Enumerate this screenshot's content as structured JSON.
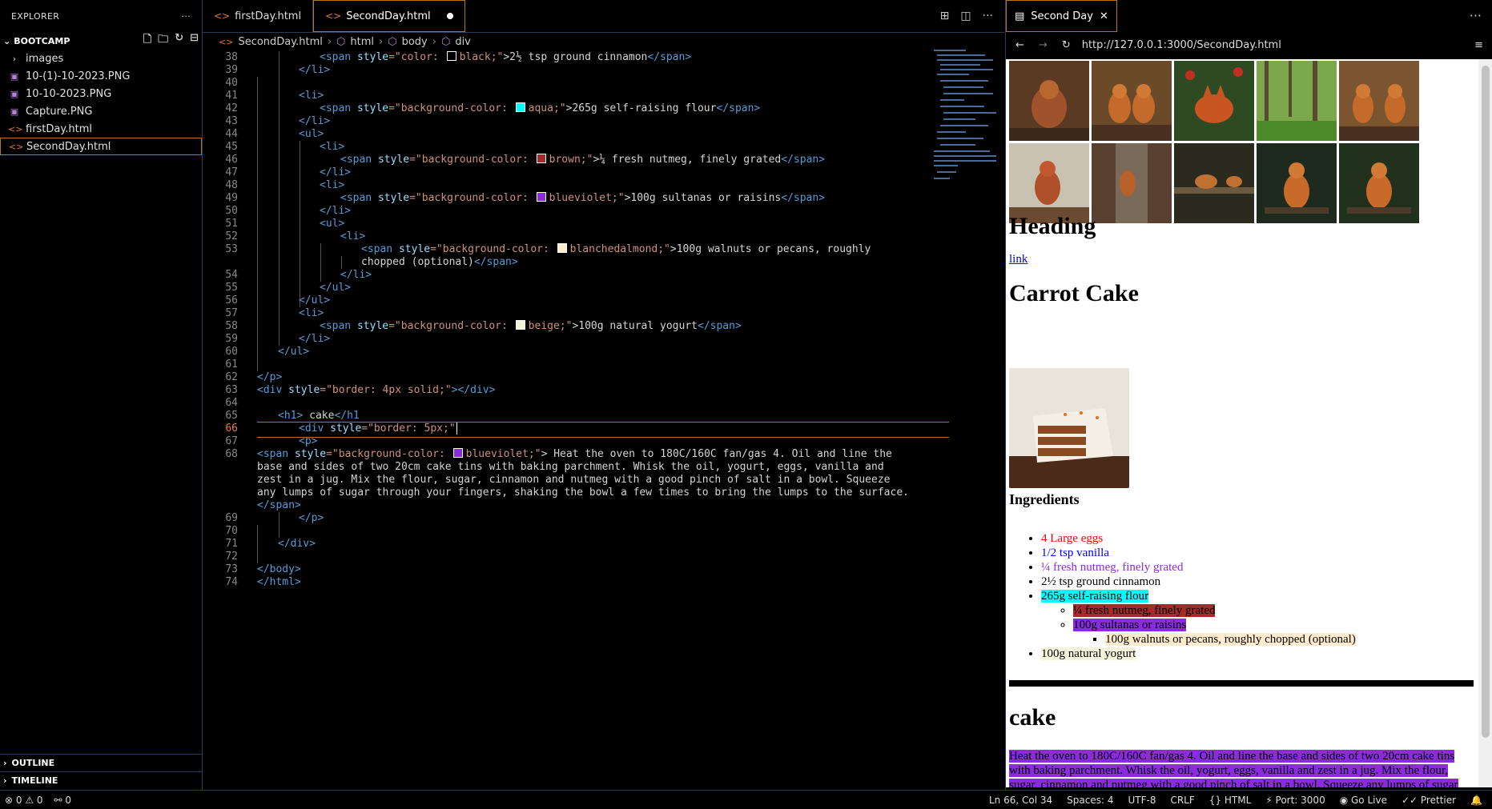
{
  "explorer": {
    "title": "EXPLORER",
    "more": "···",
    "folder": "BOOTCAMP",
    "items": [
      {
        "label": "images",
        "type": "folder"
      },
      {
        "label": "10-(1)-10-2023.PNG",
        "type": "png"
      },
      {
        "label": "10-10-2023.PNG",
        "type": "png"
      },
      {
        "label": "Capture.PNG",
        "type": "png"
      },
      {
        "label": "firstDay.html",
        "type": "html"
      },
      {
        "label": "SecondDay.html",
        "type": "html",
        "selected": true
      }
    ],
    "outline": "OUTLINE",
    "timeline": "TIMELINE"
  },
  "editor": {
    "tabs": [
      {
        "label": "firstDay.html",
        "active": false
      },
      {
        "label": "SecondDay.html",
        "active": true,
        "dirty": true
      }
    ],
    "breadcrumb": [
      "SecondDay.html",
      "html",
      "body",
      "div"
    ],
    "line_numbers": [
      "38",
      "39",
      "40",
      "41",
      "42",
      "43",
      "44",
      "45",
      "46",
      "47",
      "48",
      "49",
      "50",
      "51",
      "52",
      "53",
      "54",
      "55",
      "56",
      "57",
      "58",
      "59",
      "60",
      "61",
      "62",
      "63",
      "64",
      "65",
      "66",
      "67",
      "68",
      "69",
      "70",
      "71",
      "72",
      "73",
      "74"
    ],
    "current_line": "66",
    "lines": {
      "l38": [
        "<span",
        " style",
        "=\"color: ",
        "black;\"",
        ">2½ tsp ground cinnamon",
        "</span>"
      ],
      "l39": "</li>",
      "l41": "<li>",
      "l42": [
        "<span",
        " style",
        "=\"background-color: ",
        "aqua;\"",
        ">265g self-raising flour",
        "</span>"
      ],
      "l43": "</li>",
      "l44": "<ul>",
      "l45": "<li>",
      "l46": [
        "<span",
        " style",
        "=\"background-color: ",
        "brown;\"",
        ">¼ fresh nutmeg, finely grated",
        "</span>"
      ],
      "l47": "</li>",
      "l48": "<li>",
      "l49": [
        "<span",
        " style",
        "=\"background-color: ",
        "blueviolet;\"",
        ">100g sultanas or raisins",
        "</span>"
      ],
      "l50": "</li>",
      "l51": "<ul>",
      "l52": "<li>",
      "l53a": [
        "<span",
        " style",
        "=\"background-color: ",
        "blanchedalmond;\"",
        ">100g walnuts or pecans, roughly"
      ],
      "l53b": [
        "chopped (optional)",
        "</span>"
      ],
      "l54": "</li>",
      "l55": "</ul>",
      "l56": "</ul>",
      "l57": "<li>",
      "l58": [
        "<span",
        " style",
        "=\"background-color: ",
        "beige;\"",
        ">100g natural yogurt",
        "</span>"
      ],
      "l59": "</li>",
      "l60": "</ul>",
      "l62": "</p>",
      "l63": [
        "<div",
        " style",
        "=\"border: 4px solid;\"",
        "></div>"
      ],
      "l65": [
        "<h1>",
        " cake",
        "</h1"
      ],
      "l66": [
        "<div",
        " style",
        "=\"border: 5px;\""
      ],
      "l67": "<p>",
      "l68a": [
        "<span",
        " style",
        "=\"background-color: ",
        "blueviolet;\"",
        "> Heat the oven to 180C/160C fan/gas 4. Oil and line the"
      ],
      "l68b": "base and sides of two 20cm cake tins with baking parchment. Whisk the oil, yogurt, eggs, vanilla and",
      "l68c": "zest in a jug. Mix the flour, sugar, cinnamon and nutmeg with a good pinch of salt in a bowl. Squeeze",
      "l68d": "any lumps of sugar through your fingers, shaking the bowl a few times to bring the lumps to the surface.",
      "l68e": "</span>",
      "l69": "</p>",
      "l71": "</div>",
      "l73": "</body>",
      "l74": "</html>"
    }
  },
  "browser": {
    "tab_label": "Second Day",
    "url": "http://127.0.0.1:3000/SecondDay.html",
    "page": {
      "heading": "Heading",
      "link": "link",
      "title": "Carrot Cake",
      "ingredients_heading": "Ingredients",
      "ingredients": [
        {
          "text": "4 Large eggs",
          "color": "#ff0000"
        },
        {
          "text": "1/2 tsp vanilla",
          "color": "#0000ff"
        },
        {
          "text": "¼ fresh nutmeg, finely grated",
          "color": "#8a2be2"
        },
        {
          "text": "2½ tsp ground cinnamon",
          "color": "#000000"
        },
        {
          "text": "265g self-raising flour",
          "bg": "#00ffff"
        },
        {
          "text": "¼ fresh nutmeg, finely grated",
          "bg": "#a52a2a"
        },
        {
          "text": "100g sultanas or raisins",
          "bg": "#8a2be2"
        },
        {
          "text": "100g walnuts or pecans, roughly chopped (optional)",
          "bg": "#ffebcd"
        },
        {
          "text": "100g natural yogurt",
          "bg": "#f5f5dc"
        }
      ],
      "cake_heading": "cake",
      "paragraph": "Heat the oven to 180C/160C fan/gas 4. Oil and line the base and sides of two 20cm cake tins with baking parchment. Whisk the oil, yogurt, eggs, vanilla and zest in a jug. Mix the flour, sugar, cinnamon and nutmeg with a good pinch of salt in a bowl. Squeeze any lumps of sugar through your fingers, shaking the bowl a few times to bring the lumps to the surface."
    }
  },
  "status": {
    "errors": "0",
    "warnings": "0",
    "ports": "0",
    "position": "Ln 66, Col 34",
    "spaces": "Spaces: 4",
    "encoding": "UTF-8",
    "eol": "CRLF",
    "language": "HTML",
    "port": "Port: 3000",
    "golive": "Go Live",
    "prettier": "Prettier"
  }
}
